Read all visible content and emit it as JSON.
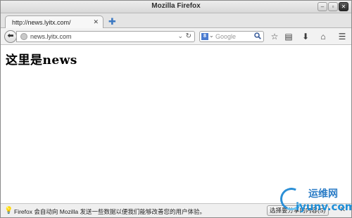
{
  "window": {
    "title": "Mozilla Firefox",
    "controls": {
      "minimize": "–",
      "maximize": "▫",
      "close": "✕"
    }
  },
  "tabs": [
    {
      "title": "http://news.lyitx.com/",
      "close_glyph": "✕"
    }
  ],
  "newtab_glyph": "✚",
  "navbar": {
    "back_glyph": "⬅",
    "url": "news.lyitx.com",
    "url_dropdown_glyph": "⌄",
    "reload_glyph": "↻",
    "search_engine_glyph": "8",
    "search_engine_dropdown_glyph": "⌄",
    "search_placeholder": "Google",
    "search_go_glyph": "🔍",
    "bookmark_star_glyph": "☆",
    "bookmarks_menu_glyph": "▤",
    "downloads_glyph": "⬇",
    "home_glyph": "⌂",
    "menu_glyph": "☰"
  },
  "content": {
    "heading": "这里是news"
  },
  "notification": {
    "bulb_glyph": "💡",
    "text": "Firefox 会自动向 Mozilla 发送一些数据以便我们能够改善您的用户体验。",
    "button_label": "选择要分享的内容(S)",
    "close_glyph": "✕"
  },
  "watermark": {
    "name": "运维网",
    "domain": "iyunv.com"
  },
  "colors": {
    "accent": "#3b78c2",
    "watermark_blue": "#1f8fd8"
  }
}
